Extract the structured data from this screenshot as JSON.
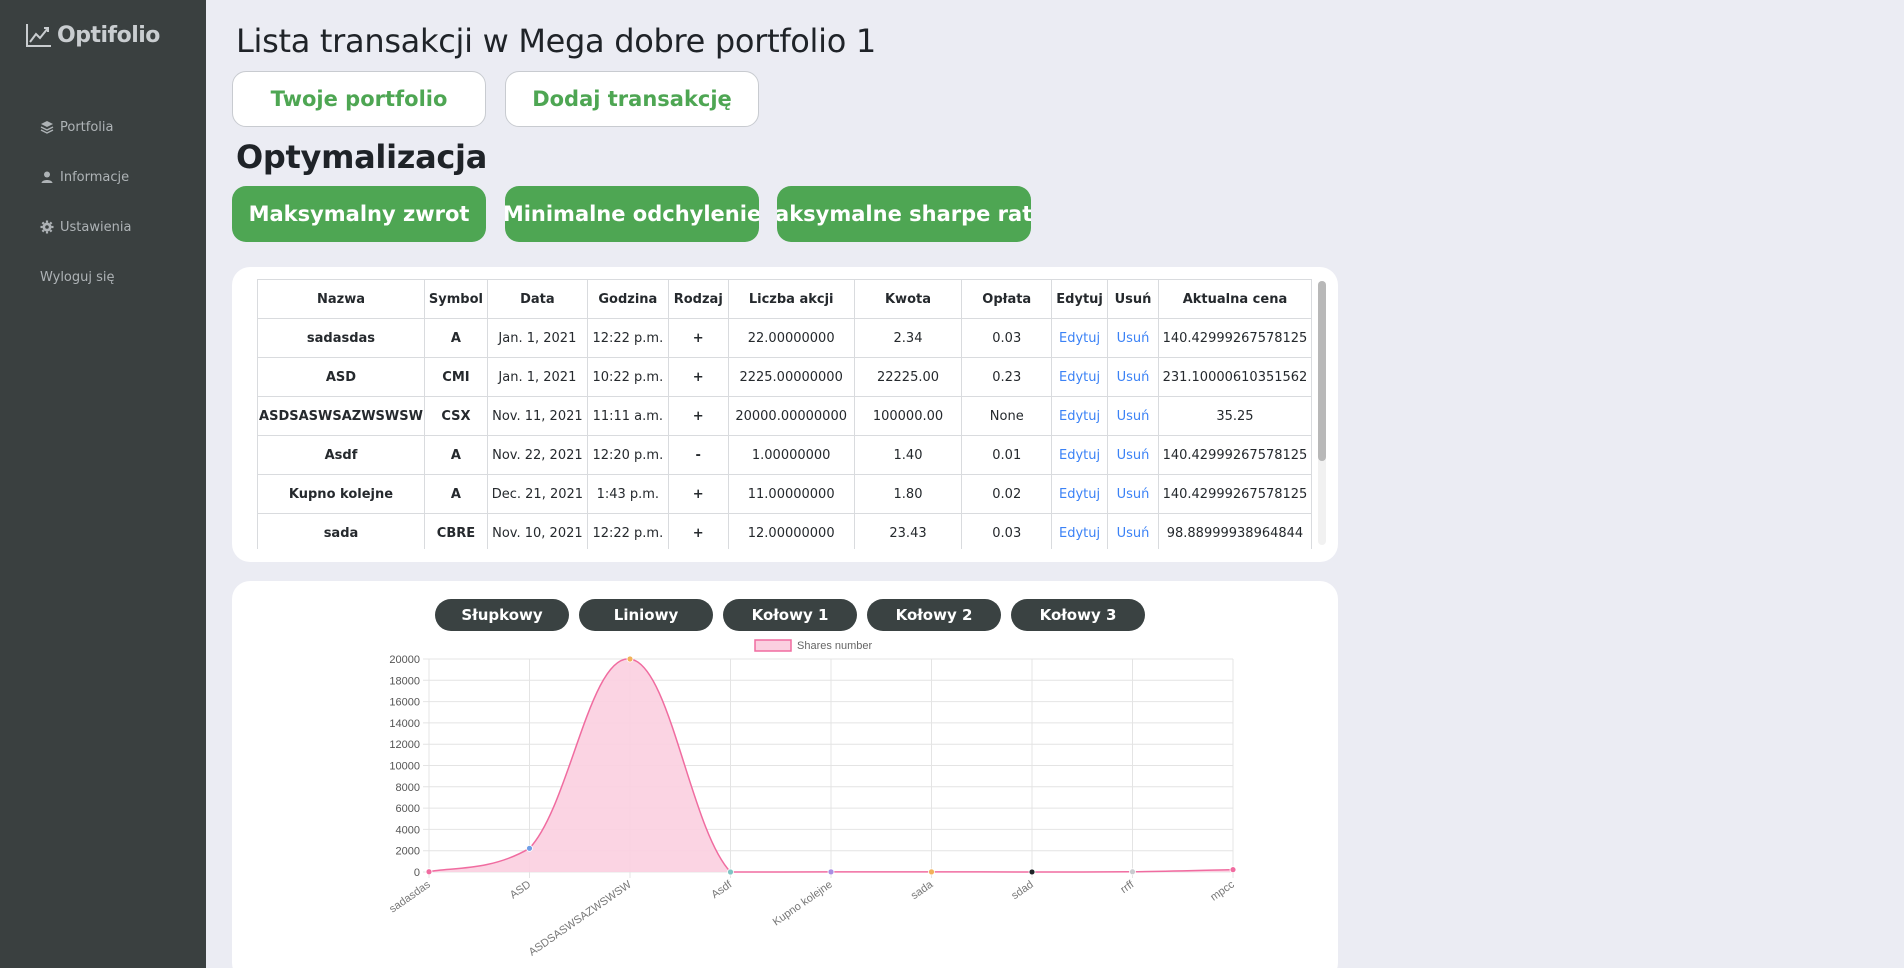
{
  "app": {
    "brand": "Optifolio"
  },
  "sidebar": {
    "items": [
      {
        "label": "Portfolia",
        "icon": "layers-icon"
      },
      {
        "label": "Informacje",
        "icon": "user-icon"
      },
      {
        "label": "Ustawienia",
        "icon": "gear-icon"
      },
      {
        "label": "Wyloguj się",
        "icon": ""
      }
    ]
  },
  "header": {
    "title": "Lista transakcji w Mega dobre portfolio 1",
    "your_portfolio": "Twoje portfolio",
    "add_transaction": "Dodaj transakcję"
  },
  "optimization": {
    "title": "Optymalizacja",
    "max_return": "Maksymalny zwrot",
    "min_deviation": "Minimalne odchylenie",
    "max_sharpe": "Maksymalne sharpe ratio"
  },
  "table": {
    "columns": [
      "Nazwa",
      "Symbol",
      "Data",
      "Godzina",
      "Rodzaj",
      "Liczba akcji",
      "Kwota",
      "Opłata",
      "Edytuj",
      "Usuń",
      "Aktualna cena"
    ],
    "rows": [
      {
        "name": "sadasdas",
        "symbol": "A",
        "date": "Jan. 1, 2021",
        "time": "12:22 p.m.",
        "type": "+",
        "shares": "22.00000000",
        "amount": "2.34",
        "fee": "0.03",
        "edit": "Edytuj",
        "delete": "Usuń",
        "price": "140.42999267578125"
      },
      {
        "name": "ASD",
        "symbol": "CMI",
        "date": "Jan. 1, 2021",
        "time": "10:22 p.m.",
        "type": "+",
        "shares": "2225.00000000",
        "amount": "22225.00",
        "fee": "0.23",
        "edit": "Edytuj",
        "delete": "Usuń",
        "price": "231.10000610351562"
      },
      {
        "name": "ASDSASWSAZWSWSW",
        "symbol": "CSX",
        "date": "Nov. 11, 2021",
        "time": "11:11 a.m.",
        "type": "+",
        "shares": "20000.00000000",
        "amount": "100000.00",
        "fee": "None",
        "edit": "Edytuj",
        "delete": "Usuń",
        "price": "35.25"
      },
      {
        "name": "Asdf",
        "symbol": "A",
        "date": "Nov. 22, 2021",
        "time": "12:20 p.m.",
        "type": "-",
        "shares": "1.00000000",
        "amount": "1.40",
        "fee": "0.01",
        "edit": "Edytuj",
        "delete": "Usuń",
        "price": "140.42999267578125"
      },
      {
        "name": "Kupno kolejne",
        "symbol": "A",
        "date": "Dec. 21, 2021",
        "time": "1:43 p.m.",
        "type": "+",
        "shares": "11.00000000",
        "amount": "1.80",
        "fee": "0.02",
        "edit": "Edytuj",
        "delete": "Usuń",
        "price": "140.42999267578125"
      },
      {
        "name": "sada",
        "symbol": "CBRE",
        "date": "Nov. 10, 2021",
        "time": "12:22 p.m.",
        "type": "+",
        "shares": "12.00000000",
        "amount": "23.43",
        "fee": "0.03",
        "edit": "Edytuj",
        "delete": "Usuń",
        "price": "98.88999938964844"
      }
    ]
  },
  "chart_tabs": [
    "Słupkowy",
    "Liniowy",
    "Kołowy 1",
    "Kołowy 2",
    "Kołowy 3"
  ],
  "colors": {
    "accent_green": "#4ea653",
    "sidebar": "#3a4040",
    "link": "#3b82f6",
    "series_fill": "#fbcfe0",
    "series_line": "#f06ca0"
  },
  "chart_data": {
    "type": "area",
    "categories": [
      "sadasdas",
      "ASD",
      "ASDSASWSAZWSWSW",
      "Asdf",
      "Kupno kolejne",
      "sada",
      "sdad",
      "rrff",
      "mpcc"
    ],
    "series": [
      {
        "name": "Shares number",
        "values": [
          22,
          2225,
          20000,
          1,
          11,
          12,
          5,
          20,
          220
        ]
      }
    ],
    "point_colors": [
      "#f06ca0",
      "#6f9ee6",
      "#f2b15a",
      "#7fc4c4",
      "#a98ee3",
      "#f2b15a",
      "#1f2328",
      "#c9cbcf",
      "#f06ca0"
    ],
    "yticks": [
      0,
      2000,
      4000,
      6000,
      8000,
      10000,
      12000,
      14000,
      16000,
      18000,
      20000
    ],
    "ylim": [
      0,
      20000
    ],
    "legend": "top",
    "grid": true
  }
}
